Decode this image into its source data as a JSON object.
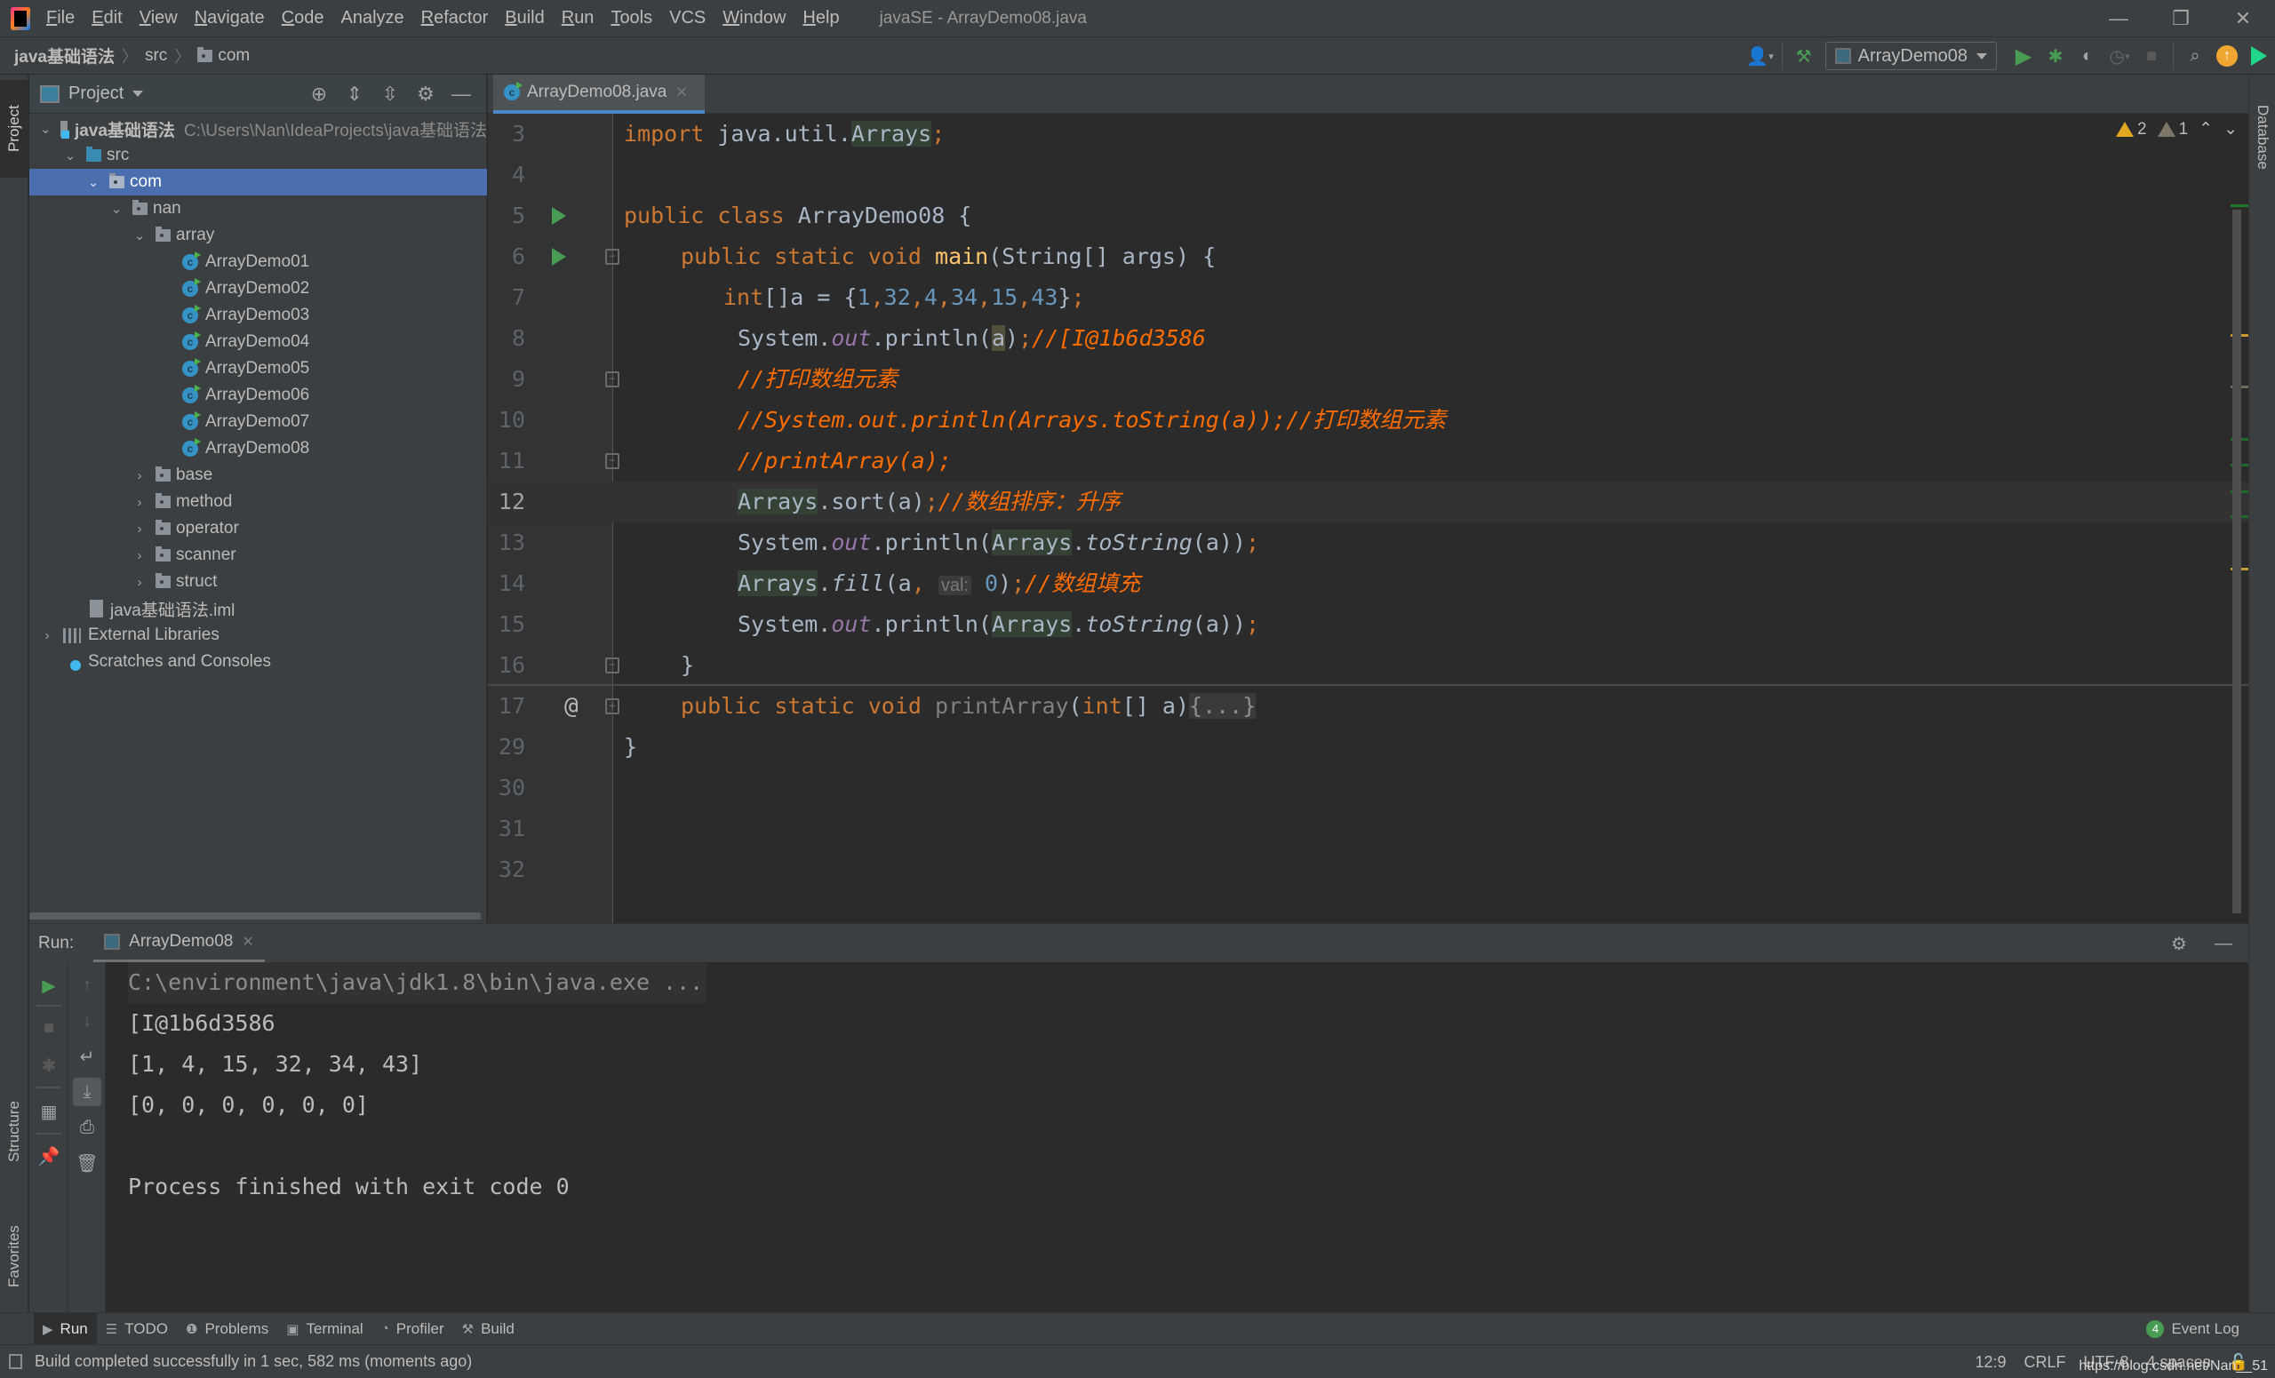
{
  "window": {
    "title": "javaSE - ArrayDemo08.java",
    "menu": [
      {
        "label": "File",
        "mnemonic": "F",
        "rest": "ile"
      },
      {
        "label": "Edit",
        "mnemonic": "E",
        "rest": "dit"
      },
      {
        "label": "View",
        "mnemonic": "V",
        "rest": "iew"
      },
      {
        "label": "Navigate",
        "mnemonic": "N",
        "rest": "avigate"
      },
      {
        "label": "Code",
        "mnemonic": "C",
        "rest": "ode"
      },
      {
        "label": "Analyze",
        "mnemonic": "",
        "rest": "Analyze"
      },
      {
        "label": "Refactor",
        "mnemonic": "R",
        "rest": "efactor"
      },
      {
        "label": "Build",
        "mnemonic": "B",
        "rest": "uild"
      },
      {
        "label": "Run",
        "mnemonic": "R",
        "rest": "un"
      },
      {
        "label": "Tools",
        "mnemonic": "T",
        "rest": "ools"
      },
      {
        "label": "VCS",
        "mnemonic": "",
        "rest": "VCS"
      },
      {
        "label": "Window",
        "mnemonic": "W",
        "rest": "indow"
      },
      {
        "label": "Help",
        "mnemonic": "H",
        "rest": "elp"
      }
    ],
    "controls": {
      "minimize": "—",
      "restore": "❐",
      "close": "✕"
    }
  },
  "navbar": {
    "breadcrumbs": [
      "java基础语法",
      "src",
      "com"
    ],
    "run_config": "ArrayDemo08"
  },
  "left_stripe": {
    "project_tab": "Project",
    "structure_tab": "Structure",
    "favorites_tab": "Favorites"
  },
  "right_stripe": {
    "database_tab": "Database"
  },
  "project": {
    "title": "Project",
    "tree": [
      {
        "label": "java基础语法",
        "path": "C:\\Users\\Nan\\IdeaProjects\\java基础语法",
        "icon": "module-icon",
        "expanded": true,
        "level": 0
      },
      {
        "label": "src",
        "icon": "source-folder-icon",
        "expanded": true,
        "level": 1
      },
      {
        "label": "com",
        "icon": "package-icon",
        "expanded": true,
        "level": 2,
        "selected": true
      },
      {
        "label": "nan",
        "icon": "package-icon",
        "expanded": true,
        "level": 3
      },
      {
        "label": "array",
        "icon": "package-icon",
        "expanded": true,
        "level": 4
      },
      {
        "label": "ArrayDemo01",
        "icon": "java-class-icon",
        "level": 5
      },
      {
        "label": "ArrayDemo02",
        "icon": "java-class-icon",
        "level": 5
      },
      {
        "label": "ArrayDemo03",
        "icon": "java-class-icon",
        "level": 5
      },
      {
        "label": "ArrayDemo04",
        "icon": "java-class-icon",
        "level": 5
      },
      {
        "label": "ArrayDemo05",
        "icon": "java-class-icon",
        "level": 5
      },
      {
        "label": "ArrayDemo06",
        "icon": "java-class-icon",
        "level": 5
      },
      {
        "label": "ArrayDemo07",
        "icon": "java-class-icon",
        "level": 5
      },
      {
        "label": "ArrayDemo08",
        "icon": "java-class-icon",
        "level": 5
      },
      {
        "label": "base",
        "icon": "package-icon",
        "expanded": false,
        "level": 4
      },
      {
        "label": "method",
        "icon": "package-icon",
        "expanded": false,
        "level": 4
      },
      {
        "label": "operator",
        "icon": "package-icon",
        "expanded": false,
        "level": 4
      },
      {
        "label": "scanner",
        "icon": "package-icon",
        "expanded": false,
        "level": 4
      },
      {
        "label": "struct",
        "icon": "package-icon",
        "expanded": false,
        "level": 4
      },
      {
        "label": "java基础语法.iml",
        "icon": "iml-file-icon",
        "level": 2
      },
      {
        "label": "External Libraries",
        "icon": "library-icon",
        "expanded": false,
        "level": 0
      },
      {
        "label": "Scratches and Consoles",
        "icon": "scratches-icon",
        "level": 0
      }
    ]
  },
  "editor": {
    "tab": "ArrayDemo08.java",
    "inspections": {
      "warnings": "2",
      "weak_warnings": "1"
    },
    "current_line": 12,
    "lines": [
      {
        "n": "3"
      },
      {
        "n": "4"
      },
      {
        "n": "5"
      },
      {
        "n": "6"
      },
      {
        "n": "7"
      },
      {
        "n": "8"
      },
      {
        "n": "9"
      },
      {
        "n": "10"
      },
      {
        "n": "11"
      },
      {
        "n": "12"
      },
      {
        "n": "13"
      },
      {
        "n": "14"
      },
      {
        "n": "15"
      },
      {
        "n": "16"
      },
      {
        "n": "17"
      },
      {
        "n": "29"
      },
      {
        "n": "30"
      },
      {
        "n": "31"
      },
      {
        "n": "32"
      }
    ],
    "code": {
      "l3": [
        "import",
        " java.util.",
        "Arrays",
        ";"
      ],
      "l5": [
        "public",
        " ",
        "class",
        " ArrayDemo08 {"
      ],
      "l6": [
        "public",
        " ",
        "static",
        " ",
        "void",
        " ",
        "main",
        "(String[] args) {"
      ],
      "l7": [
        "int",
        "[]a = {",
        "1",
        ",",
        "32",
        ",",
        "4",
        ",",
        "34",
        ",",
        "15",
        ",",
        "43",
        "}",
        ";"
      ],
      "l8": [
        "System.",
        "out",
        ".println(",
        "a",
        ")",
        ";",
        "//[I@1b6d3586"
      ],
      "l9": "//打印数组元素",
      "l10": "//System.out.println(Arrays.toString(a));//打印数组元素",
      "l11": "//printArray(a);",
      "l12": [
        "Arrays",
        ".sort(a)",
        ";",
        "//数组排序：升序"
      ],
      "l13": [
        "System.",
        "out",
        ".println(",
        "Arrays",
        ".",
        "toString",
        "(a))",
        ";"
      ],
      "l14": [
        "Arrays",
        ".",
        "fill",
        "(a",
        ",",
        "val:",
        "0",
        ")",
        ";",
        "//数组填充"
      ],
      "l15": [
        "System.",
        "out",
        ".println(",
        "Arrays",
        ".",
        "toString",
        "(a))",
        ";"
      ],
      "l16": "}",
      "l17": [
        "public",
        " ",
        "static",
        " ",
        "void",
        " ",
        "printArray",
        "(",
        "int",
        "[] a)",
        "{...}"
      ],
      "l29": "}"
    }
  },
  "run": {
    "label": "Run:",
    "tab": "ArrayDemo08",
    "console": [
      "C:\\environment\\java\\jdk1.8\\bin\\java.exe ...",
      "[I@1b6d3586",
      "[1, 4, 15, 32, 34, 43]",
      "[0, 0, 0, 0, 0, 0]",
      "",
      "Process finished with exit code 0"
    ]
  },
  "bottom_bar": {
    "items": [
      "Run",
      "TODO",
      "Problems",
      "Terminal",
      "Profiler",
      "Build"
    ],
    "event_log": "Event Log",
    "event_count": "4"
  },
  "status": {
    "message": "Build completed successfully in 1 sec, 582 ms (moments ago)",
    "position": "12:9",
    "line_sep": "CRLF",
    "encoding": "UTF-8",
    "indent": "4 spaces",
    "watermark": "https://blog.csdn.net/Nan__51"
  },
  "colors": {
    "keyword": "#cc7832",
    "number": "#6897bb",
    "comment": "#ff6d00",
    "selection": "#4b6eaf",
    "run_green": "#499c54",
    "warning": "#e0a821"
  }
}
